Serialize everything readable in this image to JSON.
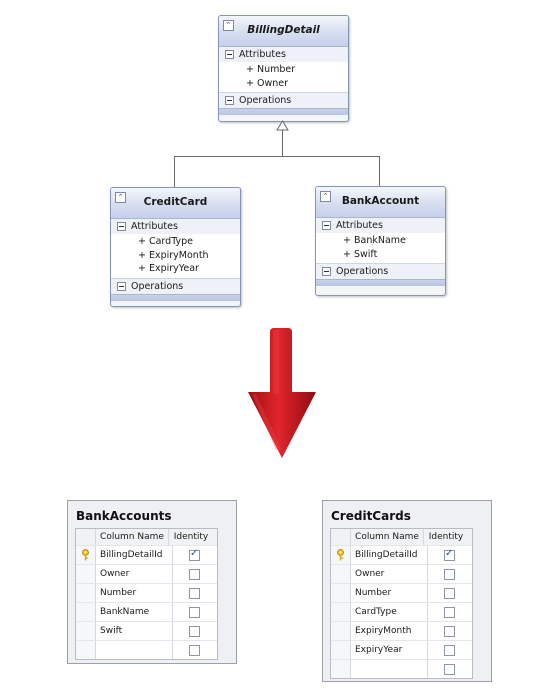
{
  "uml": {
    "billing": {
      "title": "BillingDetail",
      "attributes_label": "Attributes",
      "attributes": [
        "+ Number",
        "+ Owner"
      ],
      "operations_label": "Operations"
    },
    "creditcard": {
      "title": "CreditCard",
      "attributes_label": "Attributes",
      "attributes": [
        "+ CardType",
        "+ ExpiryMonth",
        "+ ExpiryYear"
      ],
      "operations_label": "Operations"
    },
    "bankaccount": {
      "title": "BankAccount",
      "attributes_label": "Attributes",
      "attributes": [
        "+ BankName",
        "+ Swift"
      ],
      "operations_label": "Operations"
    }
  },
  "tables": {
    "bankaccounts": {
      "title": "BankAccounts",
      "col_name_header": "Column Name",
      "identity_header": "Identity",
      "rows": [
        {
          "name": "BillingDetailId",
          "key": true,
          "identity": true
        },
        {
          "name": "Owner",
          "key": false,
          "identity": false
        },
        {
          "name": "Number",
          "key": false,
          "identity": false
        },
        {
          "name": "BankName",
          "key": false,
          "identity": false
        },
        {
          "name": "Swift",
          "key": false,
          "identity": false
        },
        {
          "name": "",
          "key": false,
          "identity": false
        }
      ]
    },
    "creditcards": {
      "title": "CreditCards",
      "col_name_header": "Column Name",
      "identity_header": "Identity",
      "rows": [
        {
          "name": "BillingDetailId",
          "key": true,
          "identity": true
        },
        {
          "name": "Owner",
          "key": false,
          "identity": false
        },
        {
          "name": "Number",
          "key": false,
          "identity": false
        },
        {
          "name": "CardType",
          "key": false,
          "identity": false
        },
        {
          "name": "ExpiryMonth",
          "key": false,
          "identity": false
        },
        {
          "name": "ExpiryYear",
          "key": false,
          "identity": false
        },
        {
          "name": "",
          "key": false,
          "identity": false
        }
      ]
    }
  },
  "colors": {
    "arrow": "#c4141b",
    "class_border": "#8496b8",
    "class_header": "#c6d0ea"
  },
  "icons": {
    "collapse": "double-chevron-up-icon",
    "section_toggle": "minus-box-icon",
    "primary_key": "key-icon",
    "identity_check": "checkbox-icon",
    "transform_arrow": "down-arrow-icon"
  }
}
